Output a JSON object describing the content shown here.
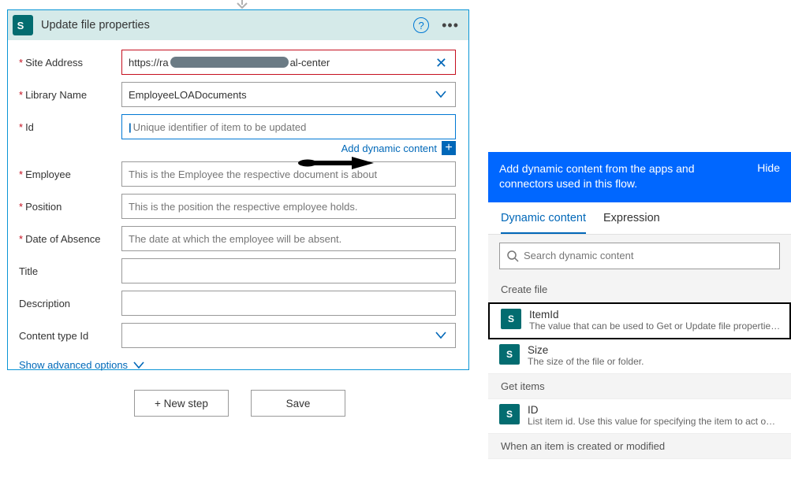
{
  "action": {
    "header_title": "Update file properties",
    "fields": {
      "site_address": {
        "label": "Site Address",
        "value_prefix": "https://ra",
        "value_suffix": "al-center"
      },
      "library_name": {
        "label": "Library Name",
        "value": "EmployeeLOADocuments"
      },
      "id": {
        "label": "Id",
        "placeholder": "Unique identifier of item to be updated"
      },
      "employee": {
        "label": "Employee",
        "placeholder": "This is the Employee the respective document is about"
      },
      "position": {
        "label": "Position",
        "placeholder": "This is the position the respective employee holds."
      },
      "date_absence": {
        "label": "Date of Absence",
        "placeholder": "The date at which the employee will be absent."
      },
      "title": {
        "label": "Title"
      },
      "description": {
        "label": "Description"
      },
      "content_type_id": {
        "label": "Content type Id"
      }
    },
    "add_dynamic_content": "Add dynamic content",
    "show_advanced": "Show advanced options"
  },
  "buttons": {
    "new_step": "+ New step",
    "save": "Save"
  },
  "panel": {
    "blue_text": "Add dynamic content from the apps and connectors used in this flow.",
    "hide": "Hide",
    "tabs": {
      "dynamic": "Dynamic content",
      "expression": "Expression"
    },
    "search_placeholder": "Search dynamic content",
    "groups": {
      "create_file": {
        "label": "Create file",
        "items": [
          {
            "title": "ItemId",
            "sub": "The value that can be used to Get or Update file properties i..."
          },
          {
            "title": "Size",
            "sub": "The size of the file or folder."
          }
        ]
      },
      "get_items": {
        "label": "Get items",
        "items": [
          {
            "title": "ID",
            "sub": "List item id. Use this value for specifying the item to act on i..."
          }
        ]
      },
      "when_item": {
        "label": "When an item is created or modified"
      }
    }
  }
}
